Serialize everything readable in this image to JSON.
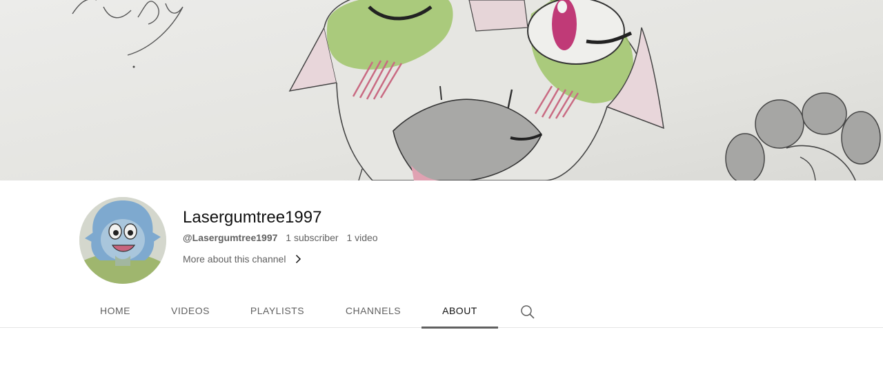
{
  "channel": {
    "name": "Lasergumtree1997",
    "handle": "@Lasergumtree1997",
    "subscribers": "1 subscriber",
    "videos": "1 video",
    "more_link": "More about this channel"
  },
  "tabs": [
    {
      "label": "HOME",
      "active": false
    },
    {
      "label": "VIDEOS",
      "active": false
    },
    {
      "label": "PLAYLISTS",
      "active": false
    },
    {
      "label": "CHANNELS",
      "active": false
    },
    {
      "label": "ABOUT",
      "active": true
    }
  ],
  "icons": {
    "more_chevron": "chevron-right-icon",
    "search": "search-icon"
  },
  "colors": {
    "text_primary": "#0f0f0f",
    "text_secondary": "#606060",
    "tab_underline": "#606060",
    "divider": "#e5e5e5"
  }
}
